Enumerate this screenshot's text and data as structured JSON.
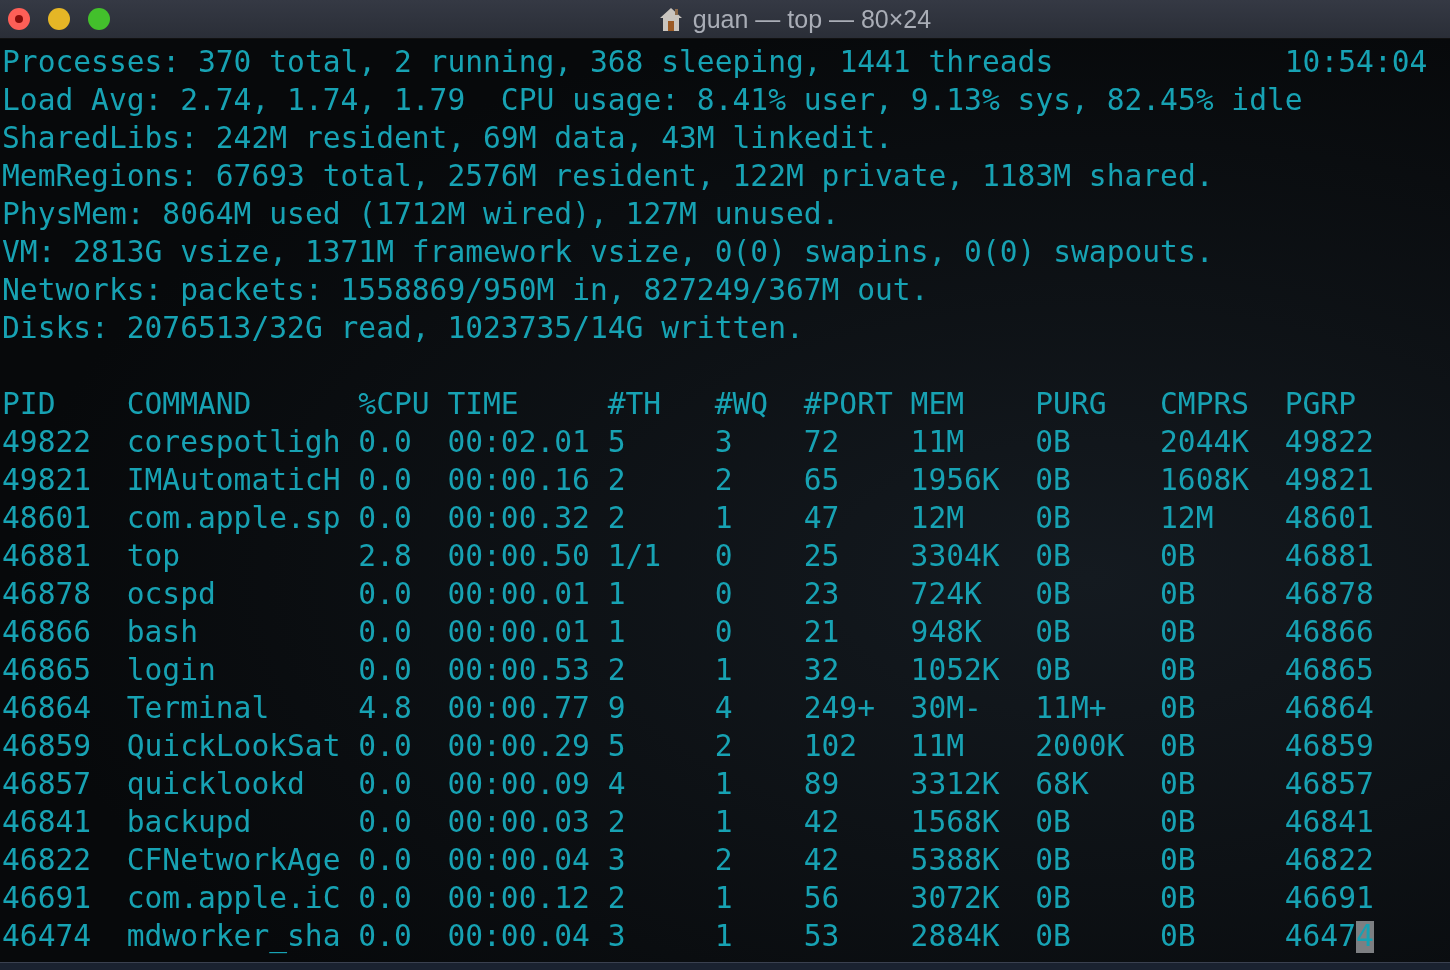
{
  "window": {
    "title": "guan — top — 80×24"
  },
  "summary": {
    "lines": [
      "Processes: 370 total, 2 running, 368 sleeping, 1441 threads",
      "Load Avg: 2.74, 1.74, 1.79  CPU usage: 8.41% user, 9.13% sys, 82.45% idle",
      "SharedLibs: 242M resident, 69M data, 43M linkedit.",
      "MemRegions: 67693 total, 2576M resident, 122M private, 1183M shared.",
      "PhysMem: 8064M used (1712M wired), 127M unused.",
      "VM: 2813G vsize, 1371M framework vsize, 0(0) swapins, 0(0) swapouts.",
      "Networks: packets: 1558869/950M in, 827249/367M out.",
      "Disks: 2076513/32G read, 1023735/14G written."
    ],
    "clock": "10:54:04"
  },
  "table": {
    "columns": [
      "PID",
      "COMMAND",
      "%CPU",
      "TIME",
      "#TH",
      "#WQ",
      "#PORT",
      "MEM",
      "PURG",
      "CMPRS",
      "PGRP"
    ],
    "rows": [
      {
        "cells": [
          "49822",
          "corespotligh",
          "0.0",
          "00:02.01",
          "5",
          "3",
          "72",
          "11M",
          "0B",
          "2044K",
          "49822"
        ],
        "cursor": false
      },
      {
        "cells": [
          "49821",
          "IMAutomaticH",
          "0.0",
          "00:00.16",
          "2",
          "2",
          "65",
          "1956K",
          "0B",
          "1608K",
          "49821"
        ],
        "cursor": false
      },
      {
        "cells": [
          "48601",
          "com.apple.sp",
          "0.0",
          "00:00.32",
          "2",
          "1",
          "47",
          "12M",
          "0B",
          "12M",
          "48601"
        ],
        "cursor": false
      },
      {
        "cells": [
          "46881",
          "top",
          "2.8",
          "00:00.50",
          "1/1",
          "0",
          "25",
          "3304K",
          "0B",
          "0B",
          "46881"
        ],
        "cursor": false
      },
      {
        "cells": [
          "46878",
          "ocspd",
          "0.0",
          "00:00.01",
          "1",
          "0",
          "23",
          "724K",
          "0B",
          "0B",
          "46878"
        ],
        "cursor": false
      },
      {
        "cells": [
          "46866",
          "bash",
          "0.0",
          "00:00.01",
          "1",
          "0",
          "21",
          "948K",
          "0B",
          "0B",
          "46866"
        ],
        "cursor": false
      },
      {
        "cells": [
          "46865",
          "login",
          "0.0",
          "00:00.53",
          "2",
          "1",
          "32",
          "1052K",
          "0B",
          "0B",
          "46865"
        ],
        "cursor": false
      },
      {
        "cells": [
          "46864",
          "Terminal",
          "4.8",
          "00:00.77",
          "9",
          "4",
          "249+",
          "30M-",
          "11M+",
          "0B",
          "46864"
        ],
        "cursor": false
      },
      {
        "cells": [
          "46859",
          "QuickLookSat",
          "0.0",
          "00:00.29",
          "5",
          "2",
          "102",
          "11M",
          "2000K",
          "0B",
          "46859"
        ],
        "cursor": false
      },
      {
        "cells": [
          "46857",
          "quicklookd",
          "0.0",
          "00:00.09",
          "4",
          "1",
          "89",
          "3312K",
          "68K",
          "0B",
          "46857"
        ],
        "cursor": false
      },
      {
        "cells": [
          "46841",
          "backupd",
          "0.0",
          "00:00.03",
          "2",
          "1",
          "42",
          "1568K",
          "0B",
          "0B",
          "46841"
        ],
        "cursor": false
      },
      {
        "cells": [
          "46822",
          "CFNetworkAge",
          "0.0",
          "00:00.04",
          "3",
          "2",
          "42",
          "5388K",
          "0B",
          "0B",
          "46822"
        ],
        "cursor": false
      },
      {
        "cells": [
          "46691",
          "com.apple.iC",
          "0.0",
          "00:00.12",
          "2",
          "1",
          "56",
          "3072K",
          "0B",
          "0B",
          "46691"
        ],
        "cursor": false
      },
      {
        "cells": [
          "46474",
          "mdworker_sha",
          "0.0",
          "00:00.04",
          "3",
          "1",
          "53",
          "2884K",
          "0B",
          "0B",
          "46474"
        ],
        "cursor": true
      }
    ]
  }
}
